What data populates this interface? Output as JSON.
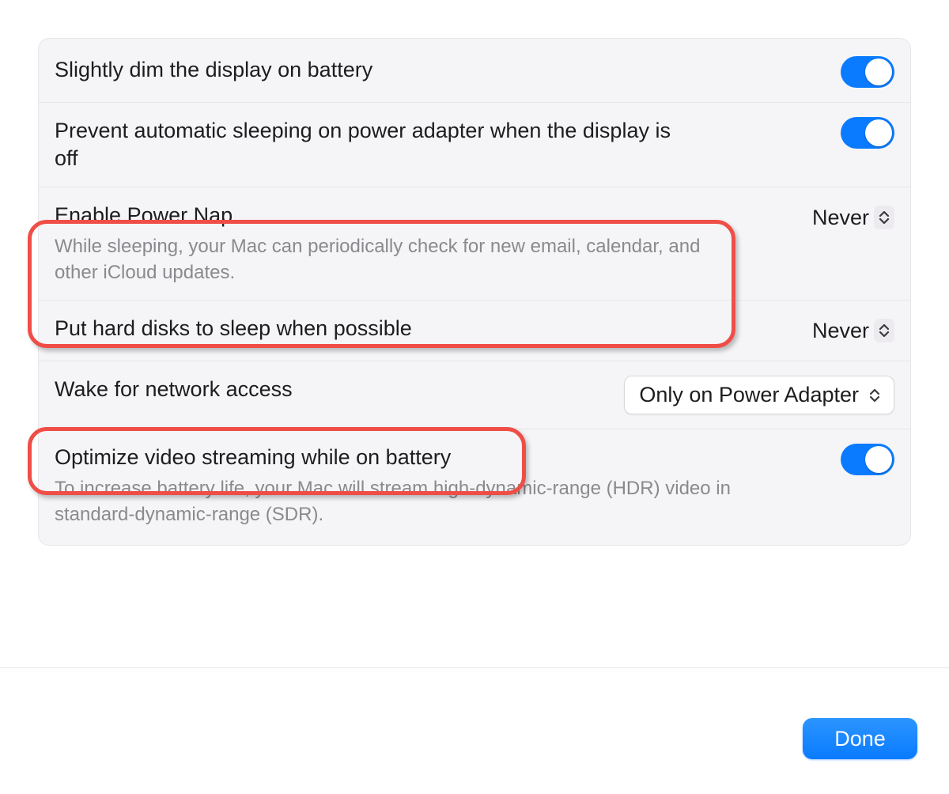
{
  "rows": {
    "dim_display": {
      "title": "Slightly dim the display on battery",
      "toggle_on": true
    },
    "prevent_sleep": {
      "title": "Prevent automatic sleeping on power adapter when the display is off",
      "toggle_on": true
    },
    "power_nap": {
      "title": "Enable Power Nap",
      "subtitle": "While sleeping, your Mac can periodically check for new email, calendar, and other iCloud updates.",
      "value": "Never"
    },
    "hard_disks": {
      "title": "Put hard disks to sleep when possible",
      "value": "Never"
    },
    "wake_network": {
      "title": "Wake for network access",
      "value": "Only on Power Adapter"
    },
    "optimize_video": {
      "title": "Optimize video streaming while on battery",
      "subtitle": "To increase battery life, your Mac will stream high-dynamic-range (HDR) video in standard-dynamic-range (SDR).",
      "toggle_on": true
    }
  },
  "footer": {
    "done_label": "Done"
  },
  "colors": {
    "accent": "#0a7bff",
    "highlight": "#ef4e47"
  }
}
